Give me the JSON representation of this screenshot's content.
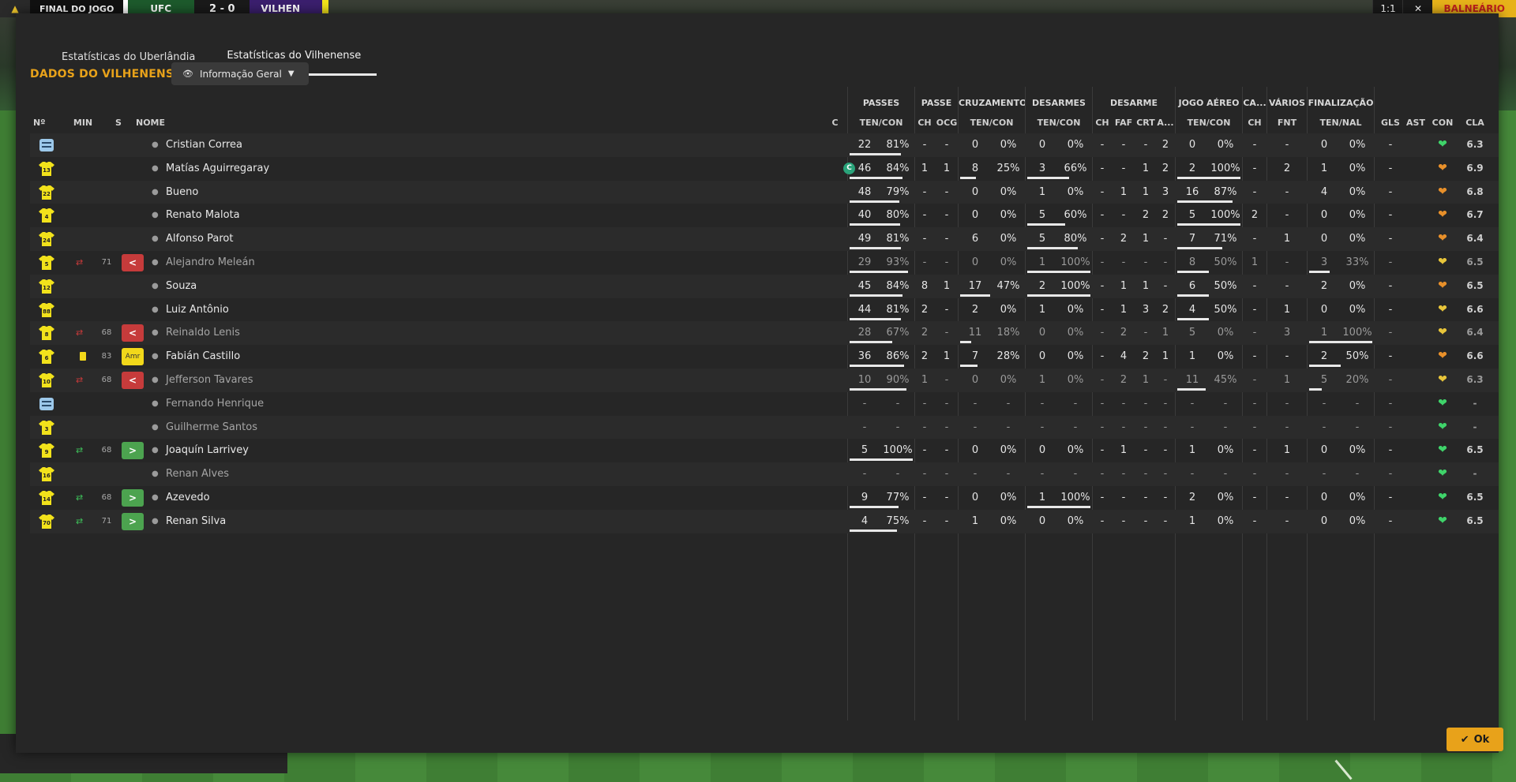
{
  "topbar": {
    "final_label": "FINAL DO JOGO",
    "team_a": "UFC",
    "score": "2 - 0",
    "team_b": "VILHEN",
    "btn_1": "1:1",
    "btn_close": "✕",
    "balneario": "BALNEÁRIO"
  },
  "tabs": [
    "Estatísticas do Uberlândia",
    "Estatísticas do Vilhenense"
  ],
  "section_title": "DADOS DO VILHENENSE",
  "view_dropdown": "Informação Geral",
  "group_headers": {
    "passes": "PASSES",
    "passe": "PASSE",
    "cruzamentos": "CRUZAMENTOS",
    "desarmes": "DESARMES",
    "desarme": "DESARME",
    "jogo_aereo": "JOGO AÉREO",
    "ca": "CA...",
    "varios": "VÁRIOS",
    "finalizacao": "FINALIZAÇÃO"
  },
  "columns": {
    "n": "Nº",
    "min": "MIN",
    "s": "S",
    "nome": "NOME",
    "c": "C",
    "passes_tc": "TEN/CON",
    "passe_ch": "CH",
    "passe_ocg": "OCG",
    "cruz_tc": "TEN/CON",
    "desarmes_tc": "TEN/CON",
    "des_ch": "CH",
    "des_faf": "FAF",
    "des_crt": "CRT",
    "des_a": "A...",
    "aereo_tc": "TEN/CON",
    "ca_ch": "CH",
    "var_fnt": "FNT",
    "fin_tn": "TEN/NAL",
    "gls": "GLS",
    "ast": "AST",
    "con": "CON",
    "cla": "CLA"
  },
  "players": [
    {
      "num": "",
      "kit": "gk",
      "sub": "",
      "min": "",
      "badge": "",
      "name": "Cristian Correa",
      "cap": "",
      "pt": "22",
      "pc": "81%",
      "pch": "-",
      "ocg": "-",
      "ct": "0",
      "cc": "0%",
      "dt": "0",
      "dc": "0%",
      "dch": "-",
      "faf": "-",
      "crt": "-",
      "da": "2",
      "at": "0",
      "ac": "0%",
      "cach": "-",
      "fnt": "-",
      "ft": "0",
      "fc": "0%",
      "gls": "-",
      "ast": "",
      "con": "green",
      "cla": "6.3",
      "dim": false
    },
    {
      "num": "13",
      "kit": "y",
      "sub": "",
      "min": "",
      "badge": "",
      "name": "Matías Aguirregaray",
      "cap": "C",
      "pt": "46",
      "pc": "84%",
      "pch": "1",
      "ocg": "1",
      "ct": "8",
      "cc": "25%",
      "dt": "3",
      "dc": "66%",
      "dch": "-",
      "faf": "-",
      "crt": "1",
      "da": "2",
      "at": "2",
      "ac": "100%",
      "cach": "-",
      "fnt": "2",
      "ft": "1",
      "fc": "0%",
      "gls": "-",
      "ast": "",
      "con": "orange",
      "cla": "6.9",
      "dim": false
    },
    {
      "num": "22",
      "kit": "y",
      "sub": "",
      "min": "",
      "badge": "",
      "name": "Bueno",
      "cap": "",
      "pt": "48",
      "pc": "79%",
      "pch": "-",
      "ocg": "-",
      "ct": "0",
      "cc": "0%",
      "dt": "1",
      "dc": "0%",
      "dch": "-",
      "faf": "1",
      "crt": "1",
      "da": "3",
      "at": "16",
      "ac": "87%",
      "cach": "-",
      "fnt": "-",
      "ft": "4",
      "fc": "0%",
      "gls": "-",
      "ast": "",
      "con": "orange",
      "cla": "6.8",
      "dim": false
    },
    {
      "num": "4",
      "kit": "y",
      "sub": "",
      "min": "",
      "badge": "",
      "name": "Renato Malota",
      "cap": "",
      "pt": "40",
      "pc": "80%",
      "pch": "-",
      "ocg": "-",
      "ct": "0",
      "cc": "0%",
      "dt": "5",
      "dc": "60%",
      "dch": "-",
      "faf": "-",
      "crt": "2",
      "da": "2",
      "at": "5",
      "ac": "100%",
      "cach": "2",
      "fnt": "-",
      "ft": "0",
      "fc": "0%",
      "gls": "-",
      "ast": "",
      "con": "orange",
      "cla": "6.7",
      "dim": false
    },
    {
      "num": "24",
      "kit": "y",
      "sub": "",
      "min": "",
      "badge": "",
      "name": "Alfonso Parot",
      "cap": "",
      "pt": "49",
      "pc": "81%",
      "pch": "-",
      "ocg": "-",
      "ct": "6",
      "cc": "0%",
      "dt": "5",
      "dc": "80%",
      "dch": "-",
      "faf": "2",
      "crt": "1",
      "da": "-",
      "at": "7",
      "ac": "71%",
      "cach": "-",
      "fnt": "1",
      "ft": "0",
      "fc": "0%",
      "gls": "-",
      "ast": "",
      "con": "orange",
      "cla": "6.4",
      "dim": false
    },
    {
      "num": "5",
      "kit": "y",
      "sub": "out",
      "min": "71",
      "badge": "out",
      "name": "Alejandro Meleán",
      "cap": "",
      "pt": "29",
      "pc": "93%",
      "pch": "-",
      "ocg": "-",
      "ct": "0",
      "cc": "0%",
      "dt": "1",
      "dc": "100%",
      "dch": "-",
      "faf": "-",
      "crt": "-",
      "da": "-",
      "at": "8",
      "ac": "50%",
      "cach": "1",
      "fnt": "-",
      "ft": "3",
      "fc": "33%",
      "gls": "-",
      "ast": "",
      "con": "yellow",
      "cla": "6.5",
      "dim": true
    },
    {
      "num": "12",
      "kit": "y",
      "sub": "",
      "min": "",
      "badge": "",
      "name": "Souza",
      "cap": "",
      "pt": "45",
      "pc": "84%",
      "pch": "8",
      "ocg": "1",
      "ct": "17",
      "cc": "47%",
      "dt": "2",
      "dc": "100%",
      "dch": "-",
      "faf": "1",
      "crt": "1",
      "da": "-",
      "at": "6",
      "ac": "50%",
      "cach": "-",
      "fnt": "-",
      "ft": "2",
      "fc": "0%",
      "gls": "-",
      "ast": "",
      "con": "orange",
      "cla": "6.5",
      "dim": false
    },
    {
      "num": "88",
      "kit": "y",
      "sub": "",
      "min": "",
      "badge": "",
      "name": "Luiz Antônio",
      "cap": "",
      "pt": "44",
      "pc": "81%",
      "pch": "2",
      "ocg": "-",
      "ct": "2",
      "cc": "0%",
      "dt": "1",
      "dc": "0%",
      "dch": "-",
      "faf": "1",
      "crt": "3",
      "da": "2",
      "at": "4",
      "ac": "50%",
      "cach": "-",
      "fnt": "1",
      "ft": "0",
      "fc": "0%",
      "gls": "-",
      "ast": "",
      "con": "yellow",
      "cla": "6.6",
      "dim": false
    },
    {
      "num": "8",
      "kit": "y",
      "sub": "out",
      "min": "68",
      "badge": "out",
      "name": "Reinaldo Lenis",
      "cap": "",
      "pt": "28",
      "pc": "67%",
      "pch": "2",
      "ocg": "-",
      "ct": "11",
      "cc": "18%",
      "dt": "0",
      "dc": "0%",
      "dch": "-",
      "faf": "2",
      "crt": "-",
      "da": "1",
      "at": "5",
      "ac": "0%",
      "cach": "-",
      "fnt": "3",
      "ft": "1",
      "fc": "100%",
      "gls": "-",
      "ast": "",
      "con": "yellow",
      "cla": "6.4",
      "dim": true
    },
    {
      "num": "6",
      "kit": "y",
      "sub": "yc",
      "min": "83",
      "badge": "amr",
      "name": "Fabián Castillo",
      "cap": "",
      "pt": "36",
      "pc": "86%",
      "pch": "2",
      "ocg": "1",
      "ct": "7",
      "cc": "28%",
      "dt": "0",
      "dc": "0%",
      "dch": "-",
      "faf": "4",
      "crt": "2",
      "da": "1",
      "at": "1",
      "ac": "0%",
      "cach": "-",
      "fnt": "-",
      "ft": "2",
      "fc": "50%",
      "gls": "-",
      "ast": "",
      "con": "orange",
      "cla": "6.6",
      "dim": false
    },
    {
      "num": "10",
      "kit": "y",
      "sub": "out",
      "min": "68",
      "badge": "out",
      "name": "Jefferson Tavares",
      "cap": "",
      "pt": "10",
      "pc": "90%",
      "pch": "1",
      "ocg": "-",
      "ct": "0",
      "cc": "0%",
      "dt": "1",
      "dc": "0%",
      "dch": "-",
      "faf": "2",
      "crt": "1",
      "da": "-",
      "at": "11",
      "ac": "45%",
      "cach": "-",
      "fnt": "1",
      "ft": "5",
      "fc": "20%",
      "gls": "-",
      "ast": "",
      "con": "yellow",
      "cla": "6.3",
      "dim": true
    },
    {
      "num": "",
      "kit": "gk",
      "sub": "",
      "min": "",
      "badge": "",
      "name": "Fernando Henrique",
      "cap": "",
      "pt": "-",
      "pc": "-",
      "pch": "-",
      "ocg": "-",
      "ct": "-",
      "cc": "-",
      "dt": "-",
      "dc": "-",
      "dch": "-",
      "faf": "-",
      "crt": "-",
      "da": "-",
      "at": "-",
      "ac": "-",
      "cach": "-",
      "fnt": "-",
      "ft": "-",
      "fc": "-",
      "gls": "-",
      "ast": "",
      "con": "green",
      "cla": "-",
      "dim": true
    },
    {
      "num": "3",
      "kit": "y",
      "sub": "",
      "min": "",
      "badge": "",
      "name": "Guilherme Santos",
      "cap": "",
      "pt": "-",
      "pc": "-",
      "pch": "-",
      "ocg": "-",
      "ct": "-",
      "cc": "-",
      "dt": "-",
      "dc": "-",
      "dch": "-",
      "faf": "-",
      "crt": "-",
      "da": "-",
      "at": "-",
      "ac": "-",
      "cach": "-",
      "fnt": "-",
      "ft": "-",
      "fc": "-",
      "gls": "-",
      "ast": "",
      "con": "green",
      "cla": "-",
      "dim": true
    },
    {
      "num": "9",
      "kit": "y",
      "sub": "in",
      "min": "68",
      "badge": "in",
      "name": "Joaquín Larrivey",
      "cap": "",
      "pt": "5",
      "pc": "100%",
      "pch": "-",
      "ocg": "-",
      "ct": "0",
      "cc": "0%",
      "dt": "0",
      "dc": "0%",
      "dch": "-",
      "faf": "1",
      "crt": "-",
      "da": "-",
      "at": "1",
      "ac": "0%",
      "cach": "-",
      "fnt": "1",
      "ft": "0",
      "fc": "0%",
      "gls": "-",
      "ast": "",
      "con": "green",
      "cla": "6.5",
      "dim": false
    },
    {
      "num": "16",
      "kit": "y",
      "sub": "",
      "min": "",
      "badge": "",
      "name": "Renan Alves",
      "cap": "",
      "pt": "-",
      "pc": "-",
      "pch": "-",
      "ocg": "-",
      "ct": "-",
      "cc": "-",
      "dt": "-",
      "dc": "-",
      "dch": "-",
      "faf": "-",
      "crt": "-",
      "da": "-",
      "at": "-",
      "ac": "-",
      "cach": "-",
      "fnt": "-",
      "ft": "-",
      "fc": "-",
      "gls": "-",
      "ast": "",
      "con": "green",
      "cla": "-",
      "dim": true
    },
    {
      "num": "14",
      "kit": "y",
      "sub": "in",
      "min": "68",
      "badge": "in",
      "name": "Azevedo",
      "cap": "",
      "pt": "9",
      "pc": "77%",
      "pch": "-",
      "ocg": "-",
      "ct": "0",
      "cc": "0%",
      "dt": "1",
      "dc": "100%",
      "dch": "-",
      "faf": "-",
      "crt": "-",
      "da": "-",
      "at": "2",
      "ac": "0%",
      "cach": "-",
      "fnt": "-",
      "ft": "0",
      "fc": "0%",
      "gls": "-",
      "ast": "",
      "con": "green",
      "cla": "6.5",
      "dim": false
    },
    {
      "num": "70",
      "kit": "y",
      "sub": "in",
      "min": "71",
      "badge": "in",
      "name": "Renan Silva",
      "cap": "",
      "pt": "4",
      "pc": "75%",
      "pch": "-",
      "ocg": "-",
      "ct": "1",
      "cc": "0%",
      "dt": "0",
      "dc": "0%",
      "dch": "-",
      "faf": "-",
      "crt": "-",
      "da": "-",
      "at": "1",
      "ac": "0%",
      "cach": "-",
      "fnt": "-",
      "ft": "0",
      "fc": "0%",
      "gls": "-",
      "ast": "",
      "con": "green",
      "cla": "6.5",
      "dim": false
    }
  ],
  "badge_labels": {
    "out": "<",
    "in": ">",
    "amr": "Amr"
  },
  "colors": {
    "accent": "#e8a21a",
    "heart_green": "#3fd46a",
    "heart_orange": "#e8902a",
    "heart_yellow": "#e8c53a",
    "kit_yellow": "#f2e21b"
  },
  "ok_button": "Ok"
}
